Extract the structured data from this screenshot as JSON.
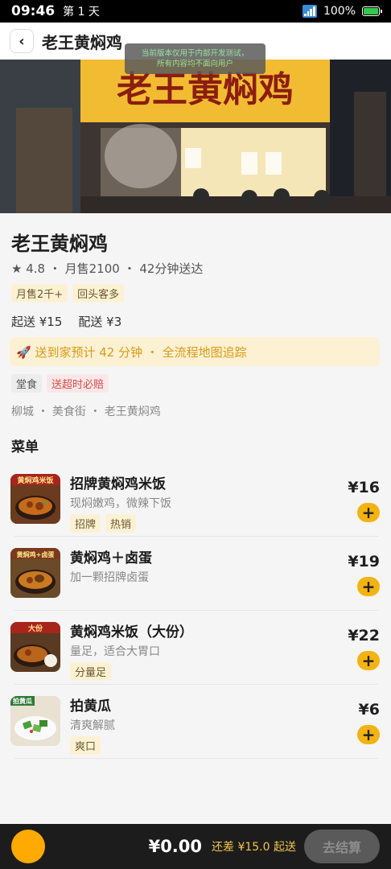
{
  "status_bar": {
    "time": "09:46",
    "day": "第 1 天",
    "battery": "100%"
  },
  "nav": {
    "back": "‹",
    "title": "老王黄焖鸡"
  },
  "dev_banner": {
    "line1": "当前版本仅用于内部开发测试，",
    "line2": "所有内容均不面向用户"
  },
  "hero": {
    "sign_text": "老王黄焖鸡"
  },
  "shop": {
    "name": "老王黄焖鸡",
    "stats": "★ 4.8 ・ 月售2100 ・ 42分钟送达",
    "tags": [
      "月售2千+",
      "回头客多"
    ],
    "min_order": "起送 ¥15",
    "delivery_fee": "配送 ¥3",
    "delivery_banner": "🚀 送到家预计 42 分钟 ・ 全流程地图追踪",
    "service_tags": [
      "堂食",
      "送超时必赔"
    ],
    "breadcrumb": "柳城 ・ 美食街 ・ 老王黄焖鸡"
  },
  "menu": {
    "title": "菜单",
    "items": [
      {
        "name": "招牌黄焖鸡米饭",
        "desc": "现焖嫩鸡，微辣下饭",
        "tags": [
          "招牌",
          "热销"
        ],
        "price": "¥16",
        "thumb_label": "黄焖鸡米饭"
      },
      {
        "name": "黄焖鸡＋卤蛋",
        "desc": "加一颗招牌卤蛋",
        "tags": [],
        "price": "¥19",
        "thumb_label": "黄焖鸡+卤蛋"
      },
      {
        "name": "黄焖鸡米饭（大份）",
        "desc": "量足，适合大胃口",
        "tags": [
          "分量足"
        ],
        "price": "¥22",
        "thumb_label": "大份"
      },
      {
        "name": "拍黄瓜",
        "desc": "清爽解腻",
        "tags": [
          "爽口"
        ],
        "price": "¥6",
        "thumb_label": "拍黄瓜"
      }
    ],
    "add_symbol": "+"
  },
  "cart": {
    "total": "¥0.00",
    "min_diff": "还差 ¥15.0 起送",
    "checkout": "去结算"
  },
  "colors": {
    "accent": "#f3b311",
    "cart_bg": "#1c1c1c",
    "delivery_bg": "#fdf1d4",
    "delivery_text": "#d99a14"
  }
}
